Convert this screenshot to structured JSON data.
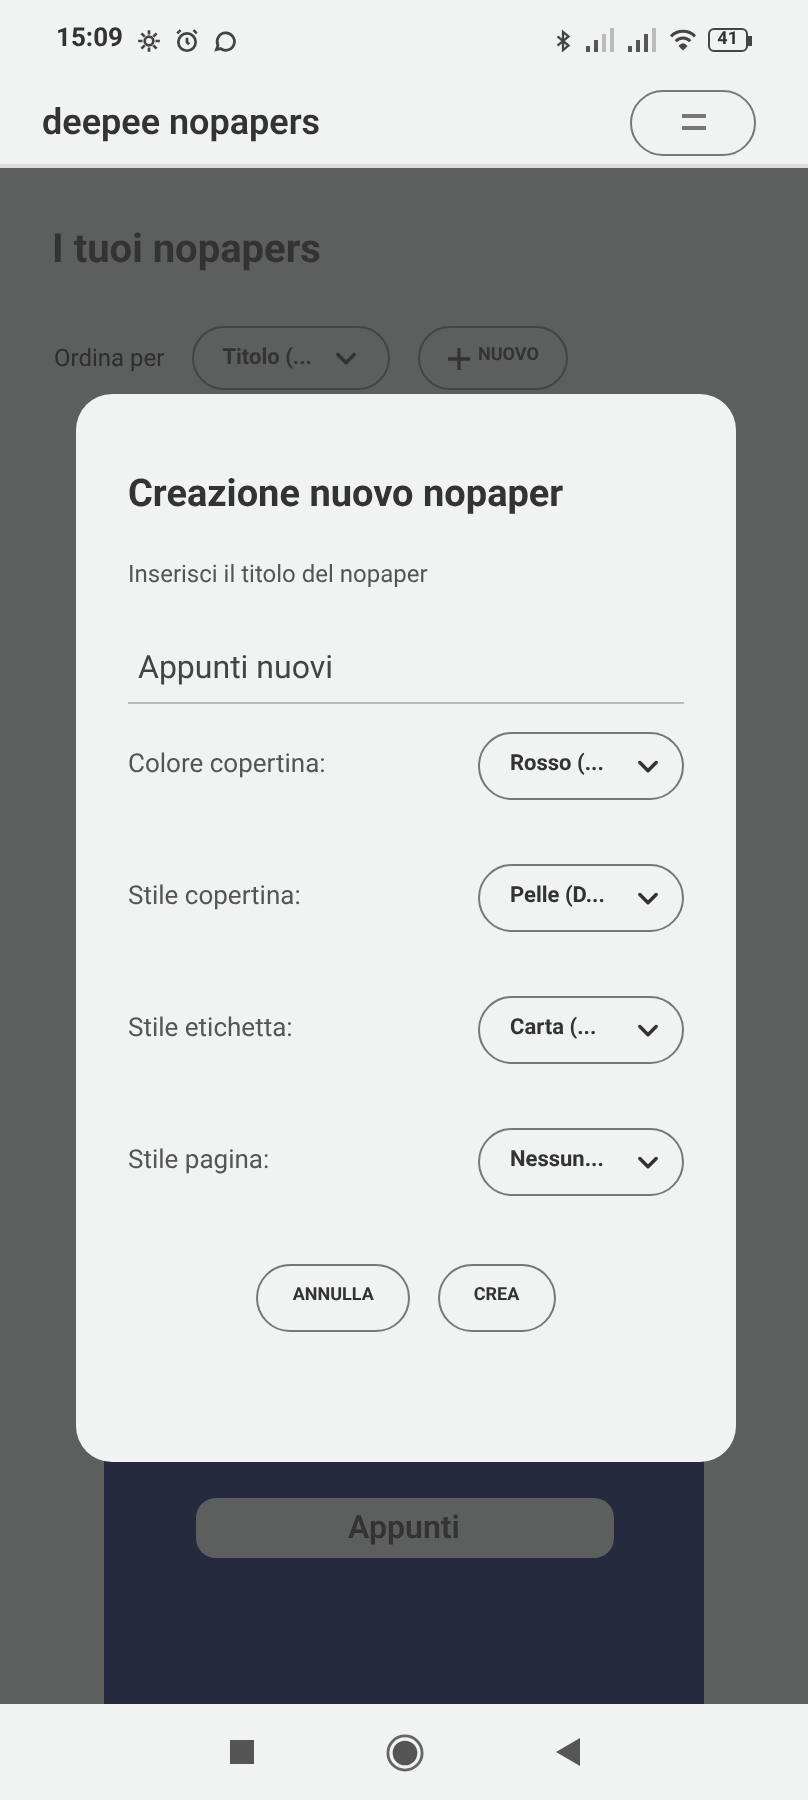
{
  "status_bar": {
    "time": "15:09",
    "battery": "41"
  },
  "app_bar": {
    "title": "deepee nopapers"
  },
  "page": {
    "title": "I tuoi nopapers",
    "sort_label": "Ordina per",
    "sort_value": "Titolo (...",
    "new_button": "NUOVO",
    "card": {
      "label": "Appunti"
    }
  },
  "dialog": {
    "title": "Creazione nuovo nopaper",
    "prompt": "Inserisci il titolo del nopaper",
    "title_value": "Appunti nuovi",
    "options": [
      {
        "label": "Colore copertina:",
        "value": "Rosso (..."
      },
      {
        "label": "Stile copertina:",
        "value": "Pelle (D..."
      },
      {
        "label": "Stile etichetta:",
        "value": "Carta (..."
      },
      {
        "label": "Stile pagina:",
        "value": "Nessun..."
      }
    ],
    "buttons": [
      "ANNULLA",
      "CREA"
    ]
  }
}
